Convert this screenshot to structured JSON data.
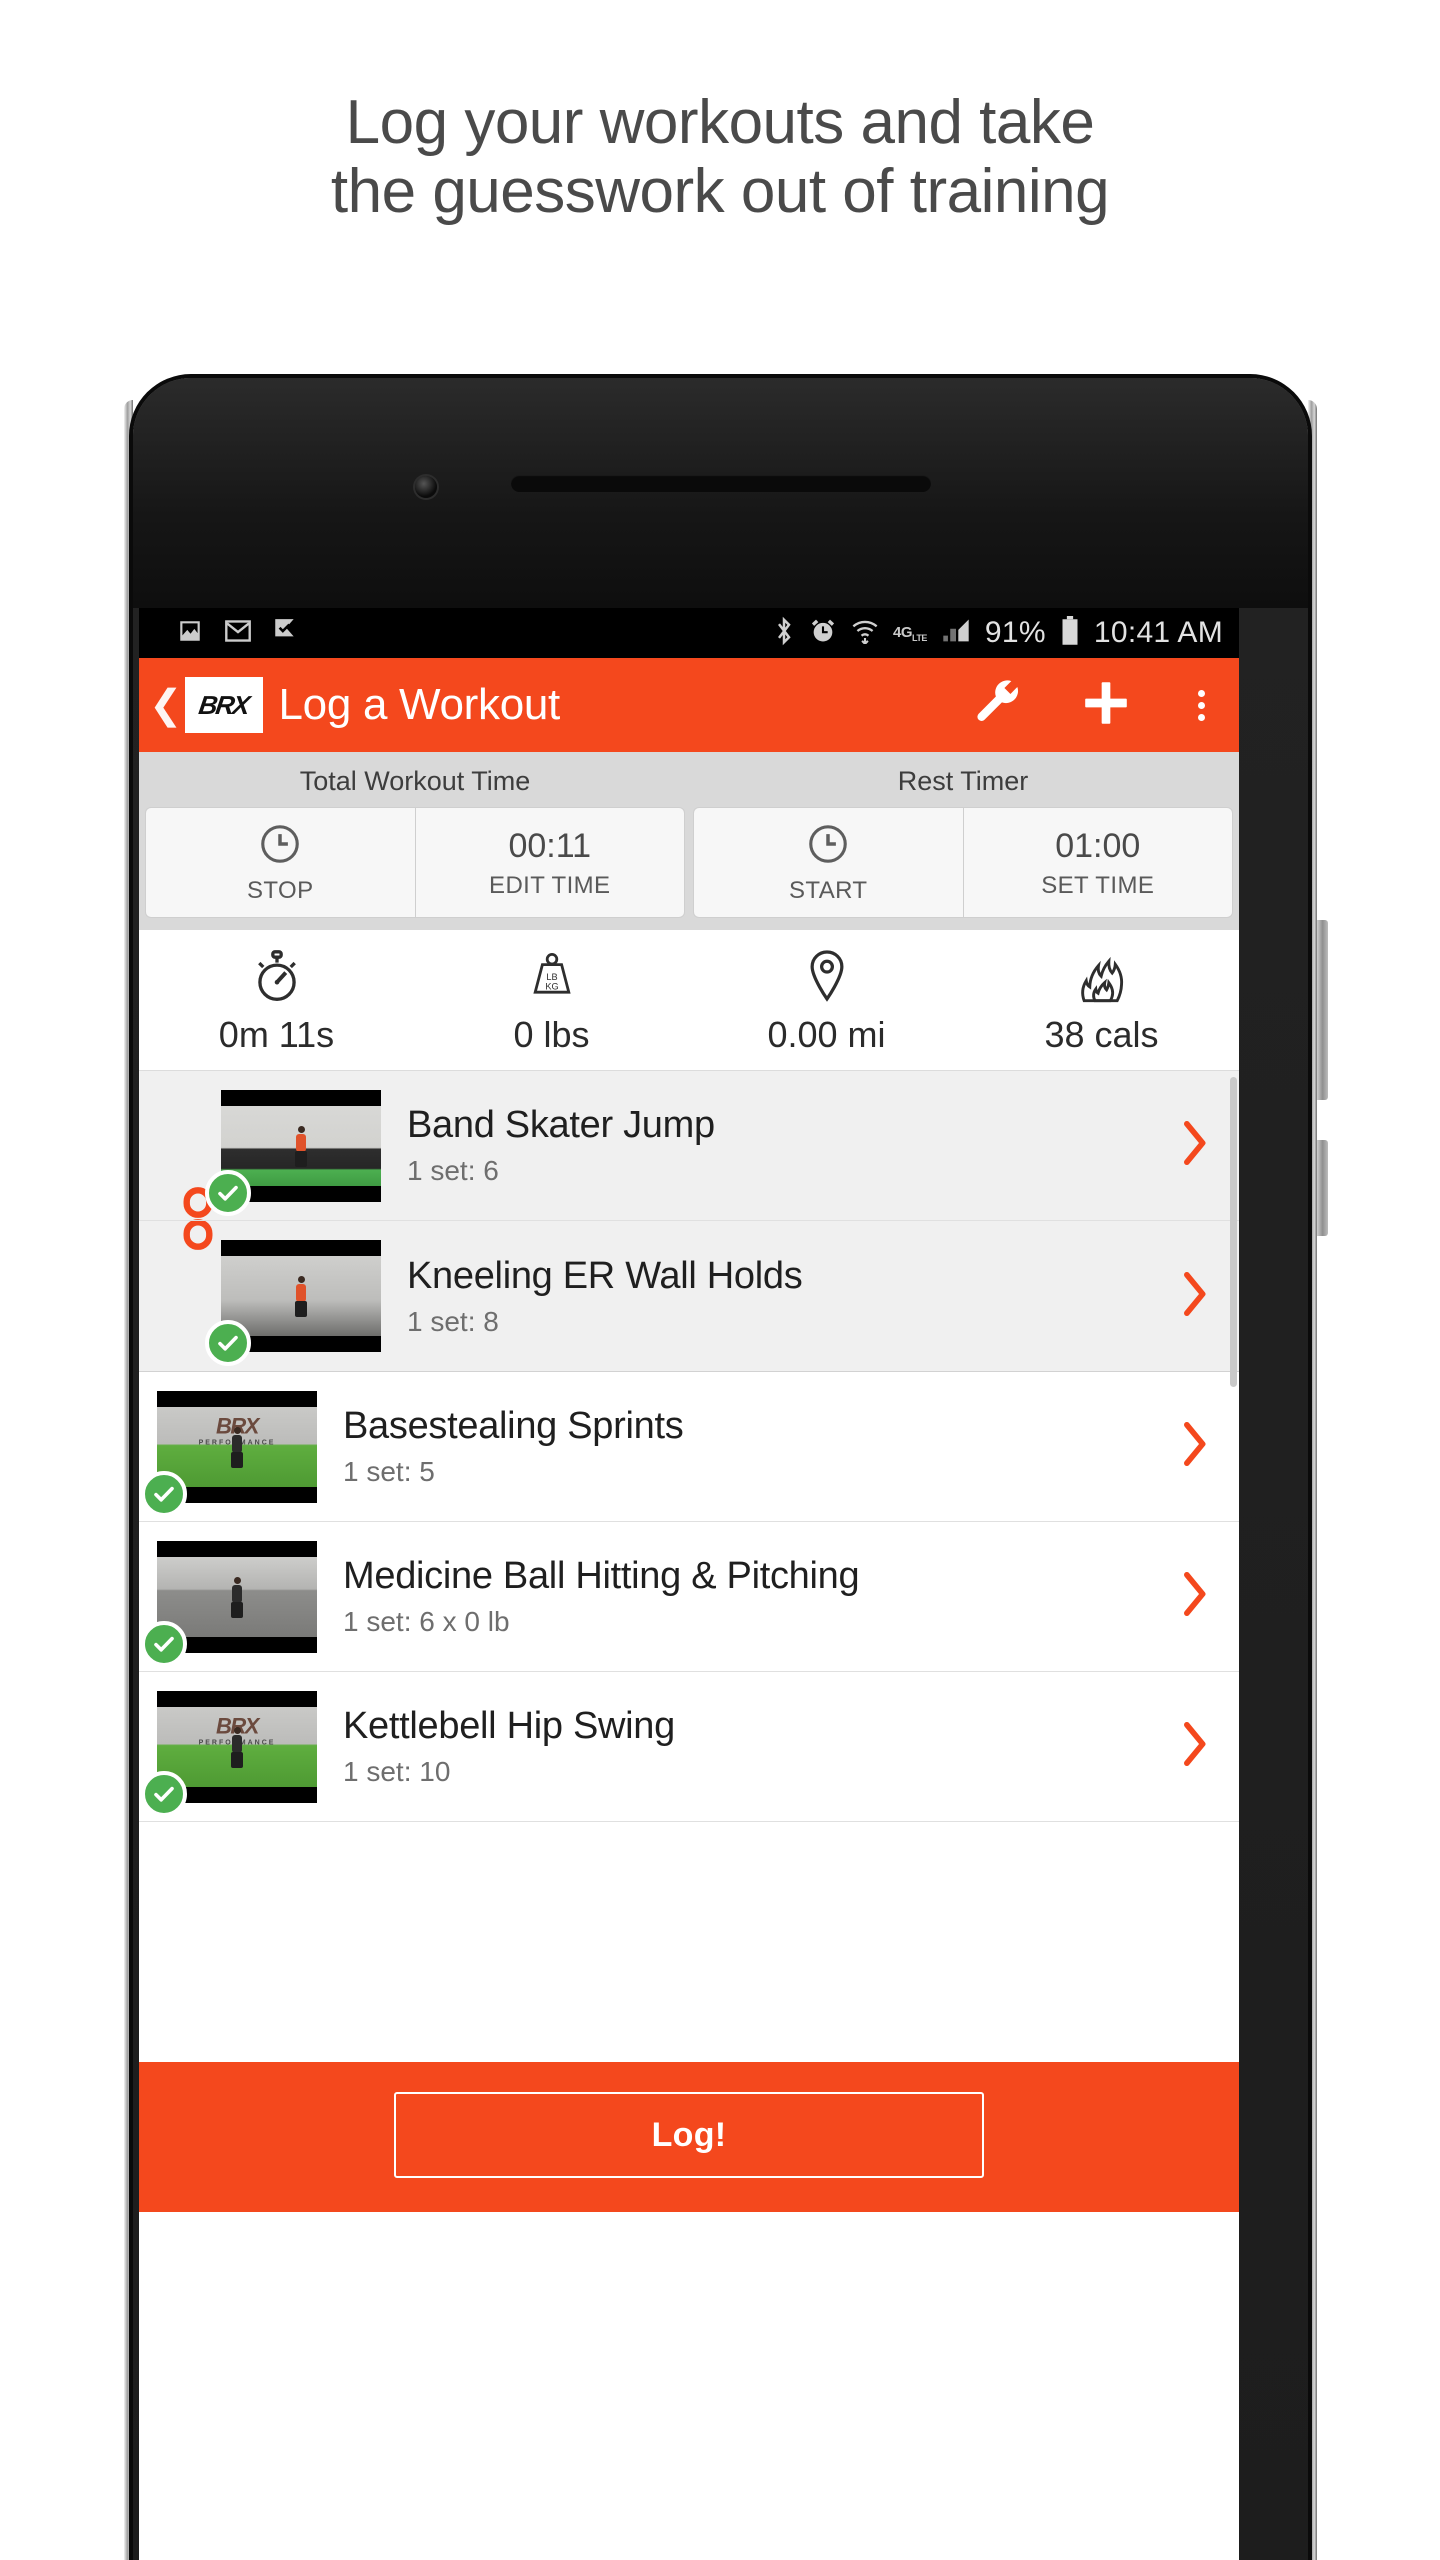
{
  "headline": {
    "line1": "Log your workouts and take",
    "line2": "the guesswork out of training"
  },
  "statusbar": {
    "left_icons": [
      "image-icon",
      "gmail-icon",
      "flag-check-icon"
    ],
    "right_icons": [
      "bluetooth-icon",
      "alarm-icon",
      "wifi-icon",
      "signal-icon",
      "battery-icon"
    ],
    "network_label": "4G",
    "network_suffix": "LTE",
    "battery_percent": "91%",
    "clock": "10:41 AM"
  },
  "appbar": {
    "back_icon": "back-chevron-icon",
    "logo_text": "BRX",
    "title": "Log a Workout",
    "actions": [
      "wrench-icon",
      "plus-icon",
      "overflow-menu-icon"
    ],
    "accent_color": "#f4481d"
  },
  "timers": [
    {
      "label": "Total Workout Time",
      "left_icon": "clock-icon",
      "left_sub": "STOP",
      "right_value": "00:11",
      "right_sub": "EDIT TIME"
    },
    {
      "label": "Rest Timer",
      "left_icon": "clock-icon",
      "left_sub": "START",
      "right_value": "01:00",
      "right_sub": "SET TIME"
    }
  ],
  "stats": [
    {
      "icon": "stopwatch-icon",
      "value": "0m 11s"
    },
    {
      "icon": "weight-icon",
      "value": "0 lbs"
    },
    {
      "icon": "location-pin-icon",
      "value": "0.00 mi"
    },
    {
      "icon": "flame-icon",
      "value": "38 cals"
    }
  ],
  "exercises": [
    {
      "name": "Band Skater Jump",
      "sets": "1 set: 6",
      "completed": true,
      "grouped": true,
      "thumb_scene": "gym",
      "thumb_brand": false,
      "chevron": "chevron-right-icon"
    },
    {
      "name": "Kneeling ER Wall Holds",
      "sets": "1 set: 8",
      "completed": true,
      "grouped": true,
      "thumb_scene": "wall",
      "thumb_brand": false,
      "chevron": "chevron-right-icon"
    },
    {
      "name": "Basestealing Sprints",
      "sets": "1 set: 5",
      "completed": true,
      "grouped": false,
      "thumb_scene": "turf",
      "thumb_brand": true,
      "chevron": "chevron-right-icon"
    },
    {
      "name": "Medicine Ball Hitting & Pitching",
      "sets": "1 set: 6 x 0 lb",
      "completed": true,
      "grouped": false,
      "thumb_scene": "court",
      "thumb_brand": false,
      "chevron": "chevron-right-icon"
    },
    {
      "name": "Kettlebell Hip Swing",
      "sets": "1 set: 10",
      "completed": true,
      "grouped": false,
      "thumb_scene": "turf",
      "thumb_brand": true,
      "chevron": "chevron-right-icon"
    }
  ],
  "superset_indicator": "chain-link-icon",
  "footer": {
    "log_label": "Log!"
  }
}
